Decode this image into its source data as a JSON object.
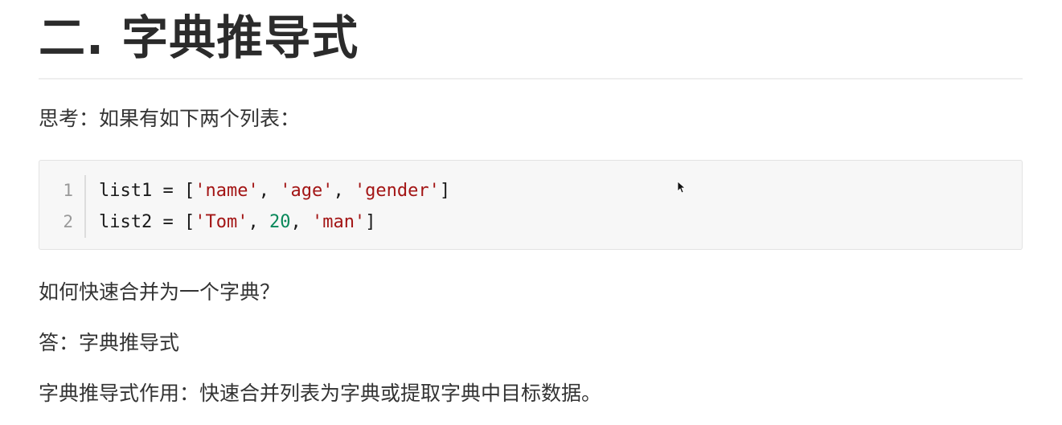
{
  "heading": "二. 字典推导式",
  "paragraphs": {
    "intro": "思考：如果有如下两个列表：",
    "question": "如何快速合并为一个字典？",
    "answer": "答：字典推导式",
    "purpose": "字典推导式作用：快速合并列表为字典或提取字典中目标数据。"
  },
  "code": {
    "lines": [
      {
        "number": "1",
        "var": "list1",
        "op": " = [",
        "items": [
          "'name'",
          ", ",
          "'age'",
          ", ",
          "'gender'"
        ],
        "close": "]"
      },
      {
        "number": "2",
        "var": "list2",
        "op": " = [",
        "items": [
          "'Tom'",
          ", ",
          "20",
          ", ",
          "'man'"
        ],
        "close": "]"
      }
    ]
  },
  "colors": {
    "string": "#a31515",
    "number": "#09885a",
    "code_background": "#f7f7f7"
  }
}
